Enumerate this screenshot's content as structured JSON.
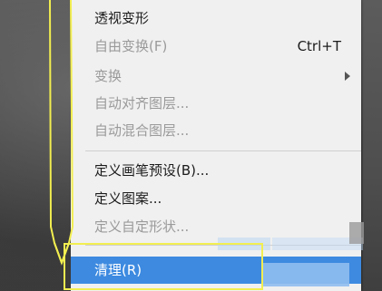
{
  "menu": {
    "items": [
      {
        "label": "透视变形",
        "enabled": true
      },
      {
        "label": "自由变换(F)",
        "shortcut": "Ctrl+T",
        "enabled": false
      },
      {
        "label": "变换",
        "enabled": false,
        "submenu": true
      },
      {
        "label": "自动对齐图层...",
        "enabled": false
      },
      {
        "label": "自动混合图层...",
        "enabled": false
      },
      {
        "label": "定义画笔预设(B)...",
        "enabled": true
      },
      {
        "label": "定义图案...",
        "enabled": true
      },
      {
        "label": "定义自定形状...",
        "enabled": false
      },
      {
        "label": "清理(R)",
        "enabled": true,
        "selected": true
      }
    ]
  },
  "colors": {
    "highlight": "#3d8ae0",
    "annotation": "#f2ee50",
    "menu_bg": "#f0f0f0"
  },
  "icons": {
    "submenu": "chevron-right-icon",
    "annotation": "down-arrow-annotation"
  }
}
